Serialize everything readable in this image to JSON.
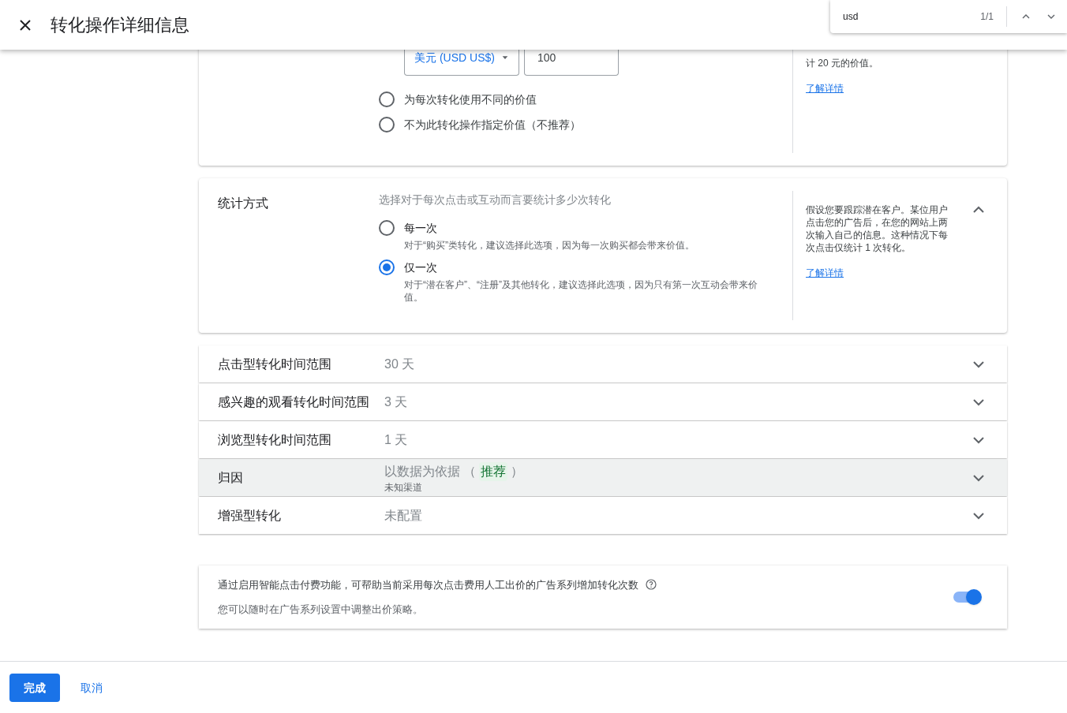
{
  "header": {
    "title": "转化操作详细信息"
  },
  "find_bar": {
    "query": "usd",
    "count": "1/1"
  },
  "value_card": {
    "currency": "美元 (USD US$)",
    "amount": "100",
    "options": [
      {
        "label": "为每次转化使用不同的价值",
        "selected": false
      },
      {
        "label": "不为此转化操作指定价值（不推荐）",
        "selected": false
      }
    ],
    "help_text": "计 20 元的价值。",
    "help_link": "了解详情"
  },
  "count_card": {
    "label": "统计方式",
    "description": "选择对于每次点击或互动而言要统计多少次转化",
    "expanded": true,
    "options": [
      {
        "label": "每一次",
        "hint": "对于“购买”类转化，建议选择此选项，因为每一次购买都会带来价值。",
        "selected": false
      },
      {
        "label": "仅一次",
        "hint": "对于“潜在客户”、“注册”及其他转化，建议选择此选项，因为只有第一次互动会带来价值。",
        "selected": true
      }
    ],
    "help_text": "假设您要跟踪潜在客户。某位用户点击您的广告后，在您的网站上两次输入自己的信息。这种情况下每次点击仅统计 1 次转化。",
    "help_link": "了解详情"
  },
  "settings_rows": [
    {
      "label": "点击型转化时间范围",
      "value": "30 天",
      "highlighted": false
    },
    {
      "label": "感兴趣的观看转化时间范围",
      "value": "3 天",
      "highlighted": false
    },
    {
      "label": "浏览型转化时间范围",
      "value": "1 天",
      "highlighted": false
    },
    {
      "label": "归因",
      "value": "以数据为依据 （",
      "badge": "推荐",
      "value_end": "）",
      "sub": "未知渠道",
      "highlighted": true
    },
    {
      "label": "增强型转化",
      "value": "未配置",
      "highlighted": false
    }
  ],
  "smart_bidding": {
    "text": "通过启用智能点击付费功能，可帮助当前采用每次点击费用人工出价的广告系列增加转化次数",
    "note": "您可以随时在广告系列设置中调整出价策略。",
    "on": true
  },
  "footer": {
    "buttons": [
      {
        "label": "完成",
        "kind": "primary"
      },
      {
        "label": "取消",
        "kind": "text"
      }
    ]
  }
}
